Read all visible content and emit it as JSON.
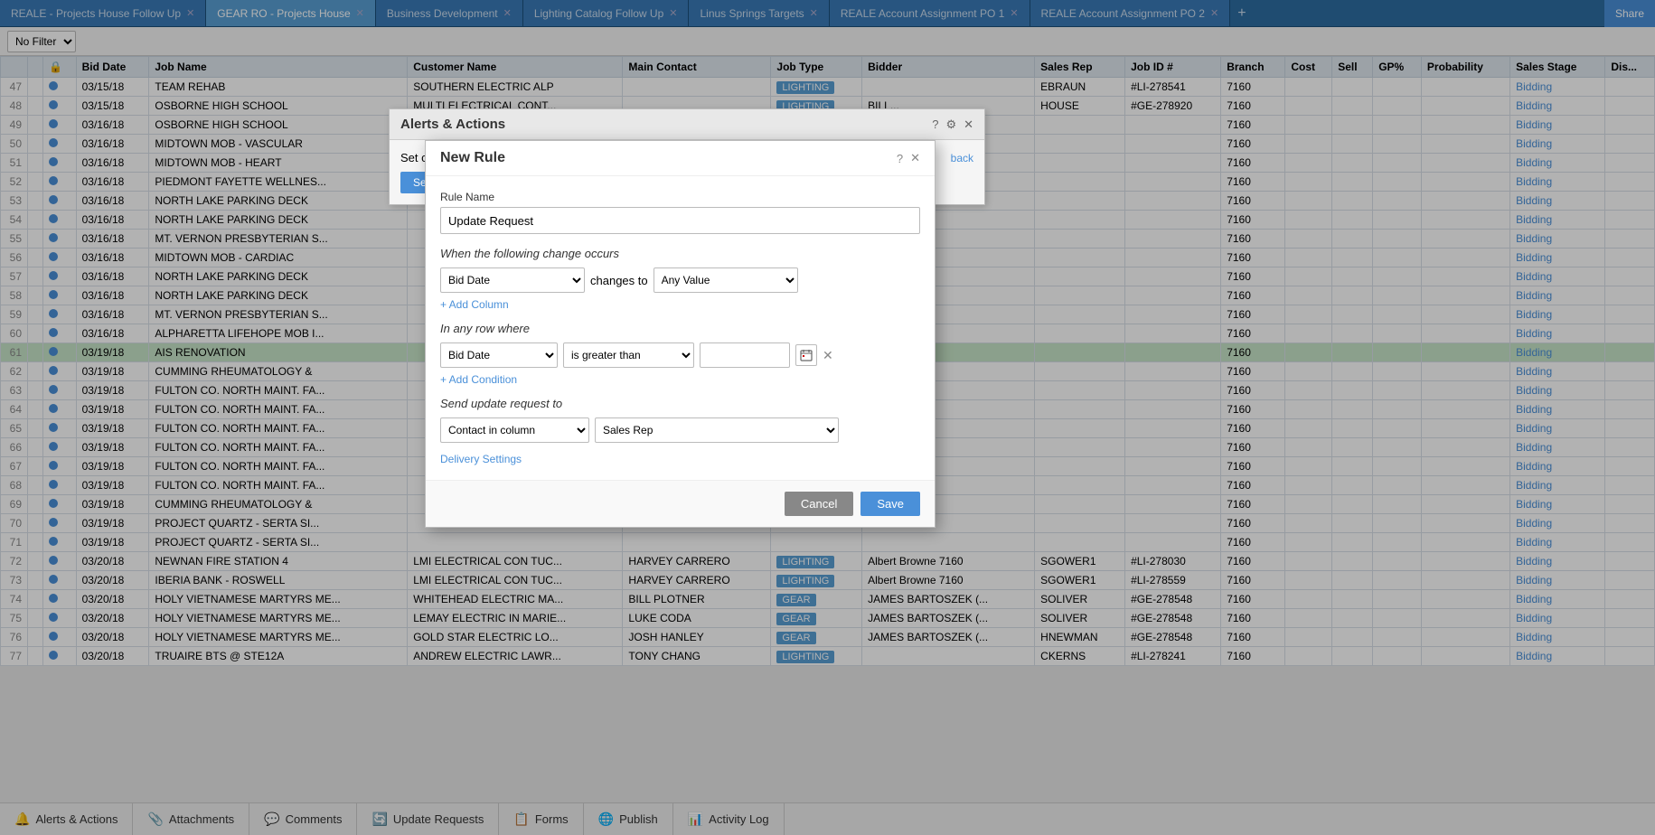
{
  "topTabs": [
    {
      "label": "REALE - Projects House Follow Up",
      "active": false
    },
    {
      "label": "GEAR RO - Projects House",
      "active": true
    },
    {
      "label": "Business Development",
      "active": false
    },
    {
      "label": "Lighting Catalog Follow Up",
      "active": false
    },
    {
      "label": "Linus Springs Targets",
      "active": false
    },
    {
      "label": "REALE Account Assignment PO 1",
      "active": false
    },
    {
      "label": "REALE Account Assignment PO 2",
      "active": false
    }
  ],
  "shareLabel": "Share",
  "filter": "No Filter",
  "columns": [
    "",
    "",
    "Status",
    "Bid Date",
    "Job Name",
    "Customer Name",
    "Main Contact",
    "Job Type",
    "Bidder",
    "Sales Rep",
    "Job ID #",
    "Branch",
    "Cost",
    "Sell",
    "GP%",
    "Probability",
    "Sales Stage",
    "Dis..."
  ],
  "rows": [
    {
      "num": "47",
      "status": "dot",
      "bidDate": "03/15/18",
      "jobName": "TEAM REHAB",
      "customer": "SOUTHERN ELECTRIC ALP",
      "mainContact": "",
      "jobType": "LIGHTING",
      "bidder": "",
      "salesRep": "EBRAUN",
      "jobId": "#LI-278541",
      "branch": "7160",
      "cost": "",
      "sell": "",
      "gp": "",
      "prob": "",
      "stage": "Bidding",
      "highlight": false
    },
    {
      "num": "48",
      "status": "dot",
      "bidDate": "03/15/18",
      "jobName": "OSBORNE HIGH SCHOOL",
      "customer": "MULTI ELECTRICAL CONT...",
      "mainContact": "",
      "jobType": "LIGHTING",
      "bidder": "BILL...",
      "salesRep": "HOUSE",
      "jobId": "#GE-278920",
      "branch": "7160",
      "cost": "",
      "sell": "",
      "gp": "",
      "prob": "",
      "stage": "Bidding",
      "highlight": false
    },
    {
      "num": "49",
      "status": "dot",
      "bidDate": "03/16/18",
      "jobName": "OSBORNE HIGH SCHOOL",
      "customer": "",
      "mainContact": "",
      "jobType": "",
      "bidder": "",
      "salesRep": "",
      "jobId": "",
      "branch": "7160",
      "cost": "",
      "sell": "",
      "gp": "",
      "prob": "",
      "stage": "Bidding",
      "highlight": false
    },
    {
      "num": "50",
      "status": "dot",
      "bidDate": "03/16/18",
      "jobName": "MIDTOWN MOB - VASCULAR",
      "customer": "",
      "mainContact": "",
      "jobType": "",
      "bidder": "",
      "salesRep": "",
      "jobId": "",
      "branch": "7160",
      "cost": "",
      "sell": "",
      "gp": "",
      "prob": "",
      "stage": "Bidding",
      "highlight": false
    },
    {
      "num": "51",
      "status": "dot",
      "bidDate": "03/16/18",
      "jobName": "MIDTOWN MOB - HEART",
      "customer": "",
      "mainContact": "",
      "jobType": "",
      "bidder": "",
      "salesRep": "",
      "jobId": "",
      "branch": "7160",
      "cost": "",
      "sell": "",
      "gp": "",
      "prob": "",
      "stage": "Bidding",
      "highlight": false
    },
    {
      "num": "52",
      "status": "dot",
      "bidDate": "03/16/18",
      "jobName": "PIEDMONT FAYETTE WELLNES...",
      "customer": "",
      "mainContact": "",
      "jobType": "",
      "bidder": "",
      "salesRep": "",
      "jobId": "",
      "branch": "7160",
      "cost": "",
      "sell": "",
      "gp": "",
      "prob": "",
      "stage": "Bidding",
      "highlight": false
    },
    {
      "num": "53",
      "status": "dot",
      "bidDate": "03/16/18",
      "jobName": "NORTH LAKE PARKING DECK",
      "customer": "",
      "mainContact": "",
      "jobType": "",
      "bidder": "",
      "salesRep": "",
      "jobId": "",
      "branch": "7160",
      "cost": "",
      "sell": "",
      "gp": "",
      "prob": "",
      "stage": "Bidding",
      "highlight": false
    },
    {
      "num": "54",
      "status": "dot",
      "bidDate": "03/16/18",
      "jobName": "NORTH LAKE PARKING DECK",
      "customer": "",
      "mainContact": "",
      "jobType": "",
      "bidder": "",
      "salesRep": "",
      "jobId": "",
      "branch": "7160",
      "cost": "",
      "sell": "",
      "gp": "",
      "prob": "",
      "stage": "Bidding",
      "highlight": false
    },
    {
      "num": "55",
      "status": "dot",
      "bidDate": "03/16/18",
      "jobName": "MT. VERNON PRESBYTERIAN S...",
      "customer": "",
      "mainContact": "",
      "jobType": "",
      "bidder": "",
      "salesRep": "",
      "jobId": "",
      "branch": "7160",
      "cost": "",
      "sell": "",
      "gp": "",
      "prob": "",
      "stage": "Bidding",
      "highlight": false
    },
    {
      "num": "56",
      "status": "dot",
      "bidDate": "03/16/18",
      "jobName": "MIDTOWN MOB - CARDIAC",
      "customer": "",
      "mainContact": "",
      "jobType": "",
      "bidder": "",
      "salesRep": "",
      "jobId": "",
      "branch": "7160",
      "cost": "",
      "sell": "",
      "gp": "",
      "prob": "",
      "stage": "Bidding",
      "highlight": false
    },
    {
      "num": "57",
      "status": "dot",
      "bidDate": "03/16/18",
      "jobName": "NORTH LAKE PARKING DECK",
      "customer": "",
      "mainContact": "",
      "jobType": "",
      "bidder": "",
      "salesRep": "",
      "jobId": "",
      "branch": "7160",
      "cost": "",
      "sell": "",
      "gp": "",
      "prob": "",
      "stage": "Bidding",
      "highlight": false
    },
    {
      "num": "58",
      "status": "dot",
      "bidDate": "03/16/18",
      "jobName": "NORTH LAKE PARKING DECK",
      "customer": "",
      "mainContact": "",
      "jobType": "",
      "bidder": "",
      "salesRep": "",
      "jobId": "",
      "branch": "7160",
      "cost": "",
      "sell": "",
      "gp": "",
      "prob": "",
      "stage": "Bidding",
      "highlight": false
    },
    {
      "num": "59",
      "status": "dot",
      "bidDate": "03/16/18",
      "jobName": "MT. VERNON PRESBYTERIAN S...",
      "customer": "",
      "mainContact": "",
      "jobType": "",
      "bidder": "",
      "salesRep": "",
      "jobId": "",
      "branch": "7160",
      "cost": "",
      "sell": "",
      "gp": "",
      "prob": "",
      "stage": "Bidding",
      "highlight": false
    },
    {
      "num": "60",
      "status": "dot",
      "bidDate": "03/16/18",
      "jobName": "ALPHARETTA LIFEHOPE MOB I...",
      "customer": "",
      "mainContact": "",
      "jobType": "",
      "bidder": "",
      "salesRep": "",
      "jobId": "",
      "branch": "7160",
      "cost": "",
      "sell": "",
      "gp": "",
      "prob": "",
      "stage": "Bidding",
      "highlight": false
    },
    {
      "num": "61",
      "status": "dot",
      "bidDate": "03/19/18",
      "jobName": "AIS RENOVATION",
      "customer": "",
      "mainContact": "",
      "jobType": "",
      "bidder": "",
      "salesRep": "",
      "jobId": "",
      "branch": "7160",
      "cost": "",
      "sell": "",
      "gp": "",
      "prob": "",
      "stage": "Bidding",
      "highlight": true
    },
    {
      "num": "62",
      "status": "dot",
      "bidDate": "03/19/18",
      "jobName": "CUMMING RHEUMATOLOGY &",
      "customer": "",
      "mainContact": "",
      "jobType": "",
      "bidder": "",
      "salesRep": "",
      "jobId": "",
      "branch": "7160",
      "cost": "",
      "sell": "",
      "gp": "",
      "prob": "",
      "stage": "Bidding",
      "highlight": false
    },
    {
      "num": "63",
      "status": "dot",
      "bidDate": "03/19/18",
      "jobName": "FULTON CO. NORTH MAINT. FA...",
      "customer": "",
      "mainContact": "",
      "jobType": "",
      "bidder": "",
      "salesRep": "",
      "jobId": "",
      "branch": "7160",
      "cost": "",
      "sell": "",
      "gp": "",
      "prob": "",
      "stage": "Bidding",
      "highlight": false
    },
    {
      "num": "64",
      "status": "dot",
      "bidDate": "03/19/18",
      "jobName": "FULTON CO. NORTH MAINT. FA...",
      "customer": "",
      "mainContact": "",
      "jobType": "",
      "bidder": "",
      "salesRep": "",
      "jobId": "",
      "branch": "7160",
      "cost": "",
      "sell": "",
      "gp": "",
      "prob": "",
      "stage": "Bidding",
      "highlight": false
    },
    {
      "num": "65",
      "status": "dot",
      "bidDate": "03/19/18",
      "jobName": "FULTON CO. NORTH MAINT. FA...",
      "customer": "",
      "mainContact": "",
      "jobType": "",
      "bidder": "",
      "salesRep": "",
      "jobId": "",
      "branch": "7160",
      "cost": "",
      "sell": "",
      "gp": "",
      "prob": "",
      "stage": "Bidding",
      "highlight": false
    },
    {
      "num": "66",
      "status": "dot",
      "bidDate": "03/19/18",
      "jobName": "FULTON CO. NORTH MAINT. FA...",
      "customer": "",
      "mainContact": "",
      "jobType": "",
      "bidder": "",
      "salesRep": "",
      "jobId": "",
      "branch": "7160",
      "cost": "",
      "sell": "",
      "gp": "",
      "prob": "",
      "stage": "Bidding",
      "highlight": false
    },
    {
      "num": "67",
      "status": "dot",
      "bidDate": "03/19/18",
      "jobName": "FULTON CO. NORTH MAINT. FA...",
      "customer": "",
      "mainContact": "",
      "jobType": "",
      "bidder": "",
      "salesRep": "",
      "jobId": "",
      "branch": "7160",
      "cost": "",
      "sell": "",
      "gp": "",
      "prob": "",
      "stage": "Bidding",
      "highlight": false
    },
    {
      "num": "68",
      "status": "dot",
      "bidDate": "03/19/18",
      "jobName": "FULTON CO. NORTH MAINT. FA...",
      "customer": "",
      "mainContact": "",
      "jobType": "",
      "bidder": "",
      "salesRep": "",
      "jobId": "",
      "branch": "7160",
      "cost": "",
      "sell": "",
      "gp": "",
      "prob": "",
      "stage": "Bidding",
      "highlight": false
    },
    {
      "num": "69",
      "status": "dot",
      "bidDate": "03/19/18",
      "jobName": "CUMMING RHEUMATOLOGY &",
      "customer": "",
      "mainContact": "",
      "jobType": "",
      "bidder": "",
      "salesRep": "",
      "jobId": "",
      "branch": "7160",
      "cost": "",
      "sell": "",
      "gp": "",
      "prob": "",
      "stage": "Bidding",
      "highlight": false
    },
    {
      "num": "70",
      "status": "dot",
      "bidDate": "03/19/18",
      "jobName": "PROJECT QUARTZ - SERTA SI...",
      "customer": "",
      "mainContact": "",
      "jobType": "",
      "bidder": "",
      "salesRep": "",
      "jobId": "",
      "branch": "7160",
      "cost": "",
      "sell": "",
      "gp": "",
      "prob": "",
      "stage": "Bidding",
      "highlight": false
    },
    {
      "num": "71",
      "status": "dot",
      "bidDate": "03/19/18",
      "jobName": "PROJECT QUARTZ - SERTA SI...",
      "customer": "",
      "mainContact": "",
      "jobType": "",
      "bidder": "",
      "salesRep": "",
      "jobId": "",
      "branch": "7160",
      "cost": "",
      "sell": "",
      "gp": "",
      "prob": "",
      "stage": "Bidding",
      "highlight": false
    },
    {
      "num": "72",
      "status": "dot",
      "bidDate": "03/20/18",
      "jobName": "NEWNAN FIRE STATION 4",
      "customer": "LMI ELECTRICAL CON TUC...",
      "mainContact": "HARVEY CARRERO",
      "jobType": "LIGHTING",
      "bidder": "Albert Browne 7160",
      "salesRep": "SGOWER1",
      "jobId": "#LI-278030",
      "branch": "7160",
      "cost": "",
      "sell": "",
      "gp": "",
      "prob": "",
      "stage": "Bidding",
      "highlight": false
    },
    {
      "num": "73",
      "status": "dot",
      "bidDate": "03/20/18",
      "jobName": "IBERIA BANK - ROSWELL",
      "customer": "LMI ELECTRICAL CON TUC...",
      "mainContact": "HARVEY CARRERO",
      "jobType": "LIGHTING",
      "bidder": "Albert Browne 7160",
      "salesRep": "SGOWER1",
      "jobId": "#LI-278559",
      "branch": "7160",
      "cost": "",
      "sell": "",
      "gp": "",
      "prob": "",
      "stage": "Bidding",
      "highlight": false
    },
    {
      "num": "74",
      "status": "dot",
      "bidDate": "03/20/18",
      "jobName": "HOLY VIETNAMESE MARTYRS ME...",
      "customer": "WHITEHEAD ELECTRIC MA...",
      "mainContact": "BILL PLOTNER",
      "jobType": "GEAR",
      "bidder": "JAMES BARTOSZEK (...",
      "salesRep": "SOLIVER",
      "jobId": "#GE-278548",
      "branch": "7160",
      "cost": "",
      "sell": "",
      "gp": "",
      "prob": "",
      "stage": "Bidding",
      "highlight": false
    },
    {
      "num": "75",
      "status": "dot",
      "bidDate": "03/20/18",
      "jobName": "HOLY VIETNAMESE MARTYRS ME...",
      "customer": "LEMAY ELECTRIC IN MARIE...",
      "mainContact": "LUKE CODA",
      "jobType": "GEAR",
      "bidder": "JAMES BARTOSZEK (...",
      "salesRep": "SOLIVER",
      "jobId": "#GE-278548",
      "branch": "7160",
      "cost": "",
      "sell": "",
      "gp": "",
      "prob": "",
      "stage": "Bidding",
      "highlight": false
    },
    {
      "num": "76",
      "status": "dot",
      "bidDate": "03/20/18",
      "jobName": "HOLY VIETNAMESE MARTYRS ME...",
      "customer": "GOLD STAR ELECTRIC LO...",
      "mainContact": "JOSH HANLEY",
      "jobType": "GEAR",
      "bidder": "JAMES BARTOSZEK (...",
      "salesRep": "HNEWMAN",
      "jobId": "#GE-278548",
      "branch": "7160",
      "cost": "",
      "sell": "",
      "gp": "",
      "prob": "",
      "stage": "Bidding",
      "highlight": false
    },
    {
      "num": "77",
      "status": "dot",
      "bidDate": "03/20/18",
      "jobName": "TRUAIRE BTS @ STE12A",
      "customer": "ANDREW ELECTRIC LAWR...",
      "mainContact": "TONY CHANG",
      "jobType": "LIGHTING",
      "bidder": "",
      "salesRep": "CKERNS",
      "jobId": "#LI-278241",
      "branch": "7160",
      "cost": "",
      "sell": "",
      "gp": "",
      "prob": "",
      "stage": "Bidding",
      "highlight": false
    }
  ],
  "alertsPanel": {
    "title": "Alerts & Actions",
    "setConditionLabel": "Set c",
    "backLabel": "back",
    "sendLabel": "Send",
    "helpIcon": "?",
    "settingsIcon": "⚙",
    "closeIcon": "✕"
  },
  "modal": {
    "title": "New Rule",
    "helpIcon": "?",
    "closeIcon": "✕",
    "ruleNameLabel": "Rule Name",
    "ruleNameValue": "Update Request",
    "whenLabel": "When the following change occurs",
    "changeColumn": "Bid Date",
    "changesToLabel": "changes to",
    "changesToValue": "Any Value",
    "addColumnLabel": "+ Add Column",
    "inAnyRowLabel": "In any row where",
    "conditionColumn": "Bid Date",
    "conditionOperator": "is greater than",
    "conditionValue": "",
    "addConditionLabel": "+ Add Condition",
    "sendUpdateLabel": "Send update request to",
    "sendTo1": "Contact in column",
    "sendTo2": "Sales Rep",
    "deliverySettingsLabel": "Delivery Settings",
    "cancelLabel": "Cancel",
    "saveLabel": "Save"
  },
  "bottomBar": {
    "alertsActions": "Alerts & Actions",
    "attachments": "Attachments",
    "comments": "Comments",
    "updateRequests": "Update Requests",
    "forms": "Forms",
    "publish": "Publish",
    "activityLog": "Activity Log"
  }
}
